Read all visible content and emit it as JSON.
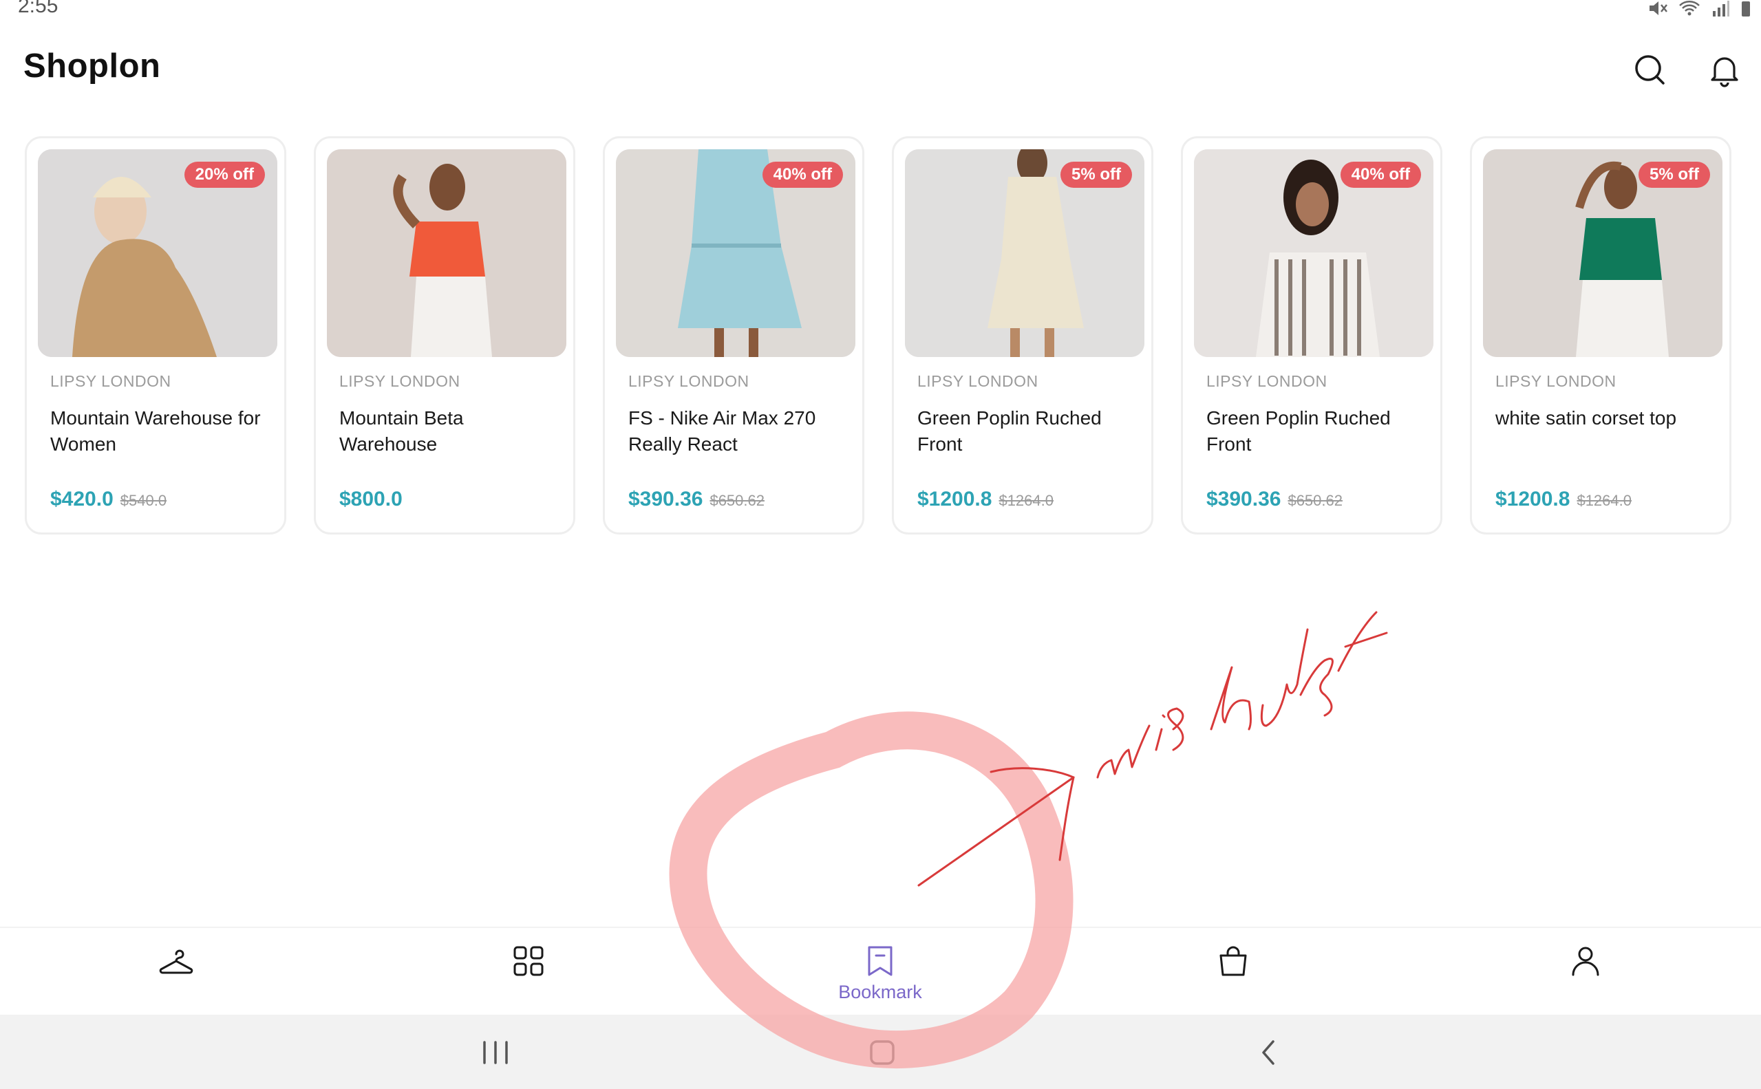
{
  "status_bar": {
    "time": "2:55"
  },
  "header": {
    "title": "Shoplon"
  },
  "products": [
    {
      "brand": "LIPSY LONDON",
      "name": "Mountain Warehouse for Women",
      "price": "$420.0",
      "old_price": "$540.0",
      "discount": "20% off"
    },
    {
      "brand": "LIPSY LONDON",
      "name": "Mountain Beta Warehouse",
      "price": "$800.0",
      "old_price": "",
      "discount": ""
    },
    {
      "brand": "LIPSY LONDON",
      "name": "FS - Nike Air Max 270 Really React",
      "price": "$390.36",
      "old_price": "$650.62",
      "discount": "40% off"
    },
    {
      "brand": "LIPSY LONDON",
      "name": "Green Poplin Ruched Front",
      "price": "$1200.8",
      "old_price": "$1264.0",
      "discount": "5% off"
    },
    {
      "brand": "LIPSY LONDON",
      "name": "Green Poplin Ruched Front",
      "price": "$390.36",
      "old_price": "$650.62",
      "discount": "40% off"
    },
    {
      "brand": "LIPSY LONDON",
      "name": "white satin corset top",
      "price": "$1200.8",
      "old_price": "$1264.0",
      "discount": "5% off"
    }
  ],
  "bottom_nav": {
    "items": [
      {
        "icon": "hanger-icon",
        "label": ""
      },
      {
        "icon": "grid-icon",
        "label": ""
      },
      {
        "icon": "bookmark-icon",
        "label": "Bookmark",
        "active": true
      },
      {
        "icon": "bag-icon",
        "label": ""
      },
      {
        "icon": "profile-icon",
        "label": ""
      }
    ]
  },
  "annotation": {
    "text": "wishlist"
  },
  "colors": {
    "accent": "#2da3b4",
    "badge": "#e65a60",
    "nav_active": "#7b68c9",
    "annotation": "#e04848"
  }
}
